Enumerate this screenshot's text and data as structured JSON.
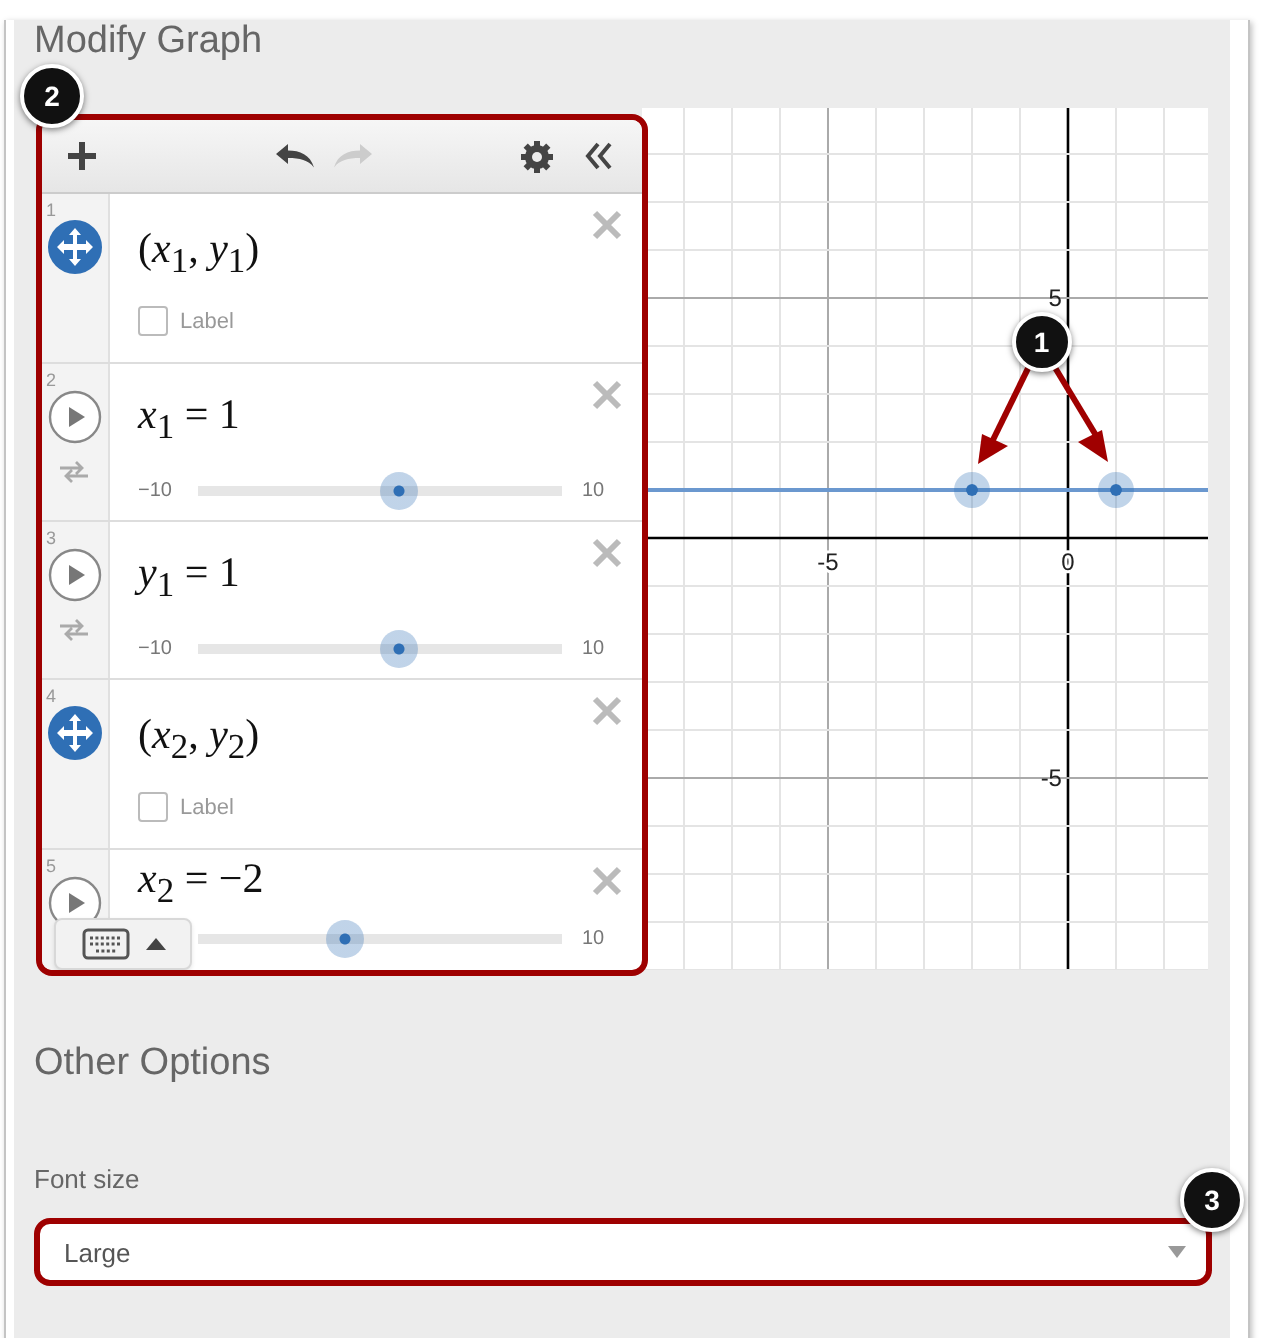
{
  "title": "Modify Graph",
  "toolbar": {
    "undo_disabled": false,
    "redo_disabled": true
  },
  "expressions": [
    {
      "kind": "point",
      "number": "1",
      "expression": "(*x*$_{1}$, *y*$_{1}$)",
      "label_text": "Label",
      "label_checked": false
    },
    {
      "kind": "slider",
      "number": "2",
      "expression": "*x*$_{1}$ = 1",
      "min": "−10",
      "max": "10",
      "level": 0.55
    },
    {
      "kind": "slider",
      "number": "3",
      "expression": "*y*$_{1}$ = 1",
      "min": "−10",
      "max": "10",
      "level": 0.55
    },
    {
      "kind": "point",
      "number": "4",
      "expression": "(*x*$_{2}$, *y*$_{2}$)",
      "label_text": "Label",
      "label_checked": false
    },
    {
      "kind": "slider",
      "number": "5",
      "expression": "*x*$_{2}$ = −2",
      "max": "10",
      "level": 0.4
    }
  ],
  "graph": {
    "chart_data": {
      "type": "scatter",
      "x": [
        -2,
        1
      ],
      "series": [
        {
          "color": "#2f6fb5",
          "values": [
            1,
            1
          ]
        }
      ],
      "xlim": [
        -8.875,
        2.917
      ],
      "ylim": [
        -9,
        8.958
      ],
      "xticks": [
        -5,
        0
      ],
      "yticks": [
        -5,
        5
      ],
      "grid": true,
      "ref_lines": [
        {
          "axis": "y",
          "value": 1
        }
      ]
    }
  },
  "other_options_title": "Other Options",
  "font_size": {
    "label": "Font size",
    "value": "Large"
  },
  "callouts": [
    "1",
    "2",
    "3"
  ]
}
